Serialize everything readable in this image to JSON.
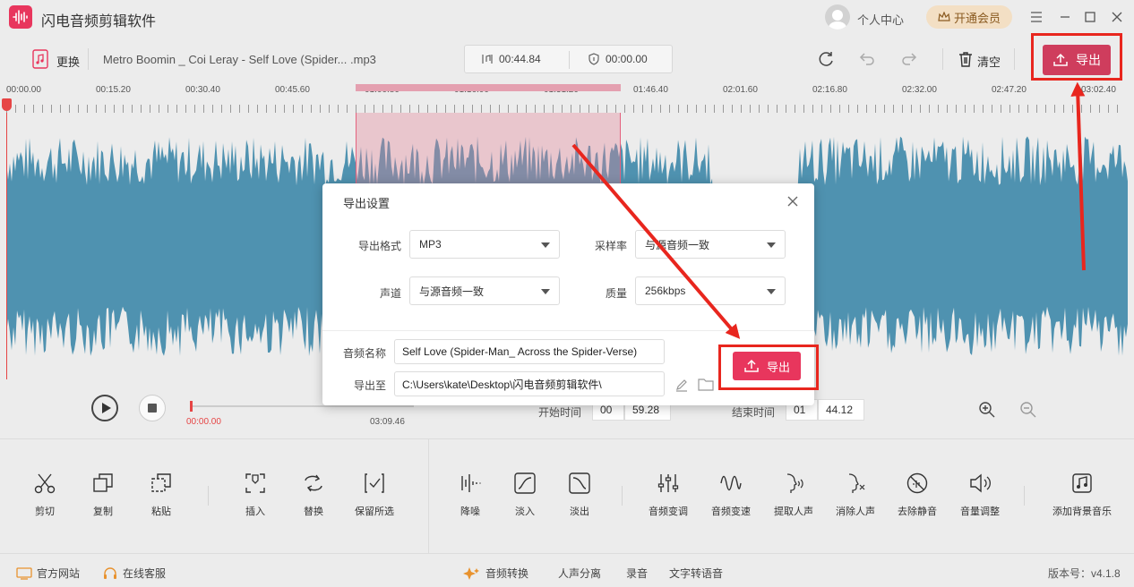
{
  "app": {
    "title": "闪电音频剪辑软件",
    "user_center": "个人中心",
    "vip_button": "开通会员"
  },
  "colors": {
    "accent": "#e8365d",
    "waveform": "#4f92b0",
    "selection": "#e682a0",
    "annotation": "#e8261e"
  },
  "toolbar": {
    "replace_label": "更换",
    "filename": "Metro Boomin _ Coi Leray - Self Love (Spider... .mp3",
    "duration": "00:44.84",
    "position": "00:00.00",
    "clear_label": "清空",
    "export_label": "导出"
  },
  "timeline": {
    "marks": [
      "00:00.00",
      "00:15.20",
      "00:30.40",
      "00:45.60",
      "01:00.80",
      "01:16.00",
      "01:31.20",
      "01:46.40",
      "02:01.60",
      "02:16.80",
      "02:32.00",
      "02:47.20",
      "03:02.40"
    ]
  },
  "transport": {
    "current_time": "00:00.00",
    "total_time": "03:09.46",
    "start_label": "开始时间",
    "start_min": "00",
    "start_sec": "59.28",
    "end_label": "结束时间",
    "end_min": "01",
    "end_sec": "44.12"
  },
  "tools": {
    "cut": "剪切",
    "copy": "复制",
    "paste": "粘贴",
    "insert": "插入",
    "replace": "替换",
    "keep": "保留所选",
    "denoise": "降噪",
    "fade_in": "淡入",
    "fade_out": "淡出",
    "voice_change": "音频变调",
    "speed": "音频变速",
    "extract_vocal": "提取人声",
    "remove_vocal": "消除人声",
    "remove_silence": "去除静音",
    "volume": "音量调整",
    "bg_music": "添加背景音乐"
  },
  "footer": {
    "website": "官方网站",
    "support": "在线客服",
    "convert": "音频转换",
    "separate": "人声分离",
    "record": "录音",
    "tts": "文字转语音",
    "version": "版本号：v4.1.8"
  },
  "dialog": {
    "title": "导出设置",
    "format_label": "导出格式",
    "format_value": "MP3",
    "samplerate_label": "采样率",
    "samplerate_value": "与源音频一致",
    "channel_label": "声道",
    "channel_value": "与源音频一致",
    "quality_label": "质量",
    "quality_value": "256kbps",
    "name_label": "音频名称",
    "name_value": "Self Love (Spider-Man_ Across the Spider-Verse)",
    "path_label": "导出至",
    "path_value": "C:\\Users\\kate\\Desktop\\闪电音频剪辑软件\\",
    "export_button": "导出"
  }
}
